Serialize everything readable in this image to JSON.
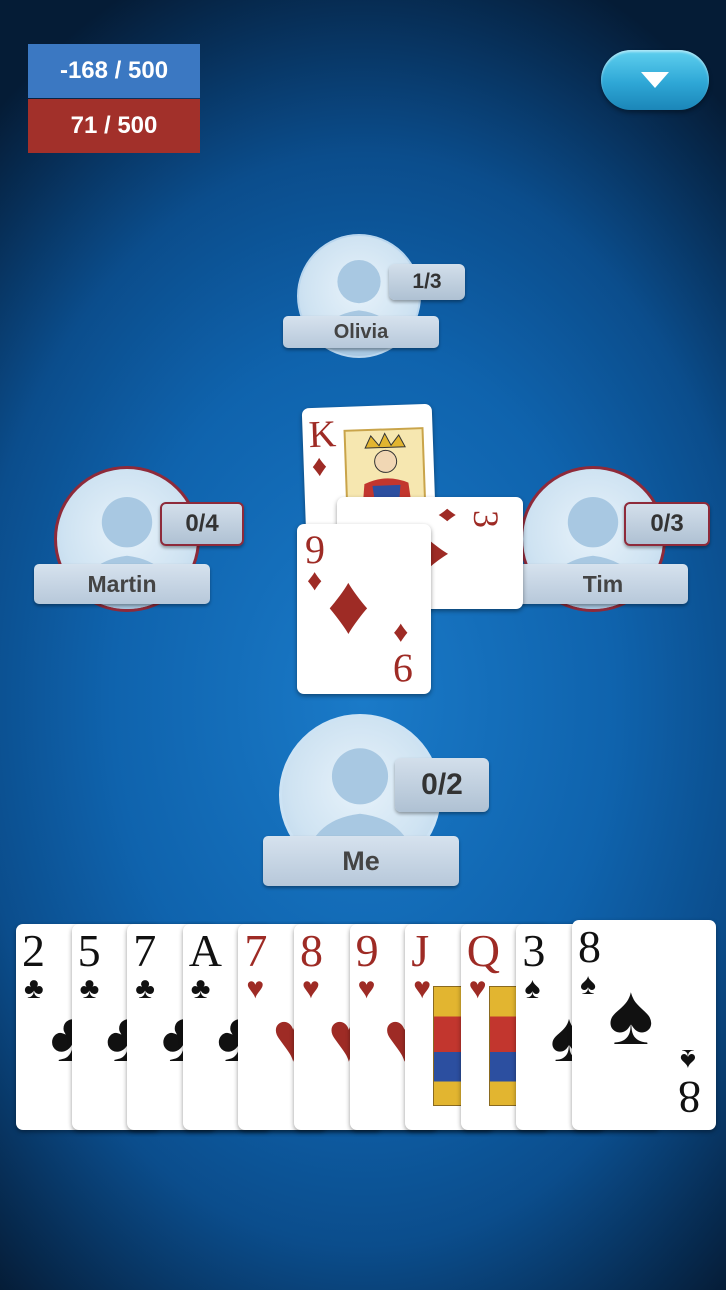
{
  "scores": {
    "team_blue": "-168 / 500",
    "team_red": "71 / 500"
  },
  "menu": {
    "icon": "chevron-down-icon"
  },
  "players": {
    "olivia": {
      "name": "Olivia",
      "tricks": "1/3"
    },
    "martin": {
      "name": "Martin",
      "tricks": "0/4"
    },
    "tim": {
      "name": "Tim",
      "tricks": "0/3"
    },
    "me": {
      "name": "Me",
      "tricks": "0/2"
    }
  },
  "trick": [
    {
      "rank": "K",
      "suit": "♦",
      "color": "red",
      "by": "Olivia"
    },
    {
      "rank": "3",
      "suit": "♦",
      "color": "red",
      "by": "Tim"
    },
    {
      "rank": "9",
      "suit": "♦",
      "color": "red",
      "by": "Me"
    }
  ],
  "hand": [
    {
      "rank": "2",
      "suit": "♣",
      "color": "black"
    },
    {
      "rank": "5",
      "suit": "♣",
      "color": "black"
    },
    {
      "rank": "7",
      "suit": "♣",
      "color": "black"
    },
    {
      "rank": "A",
      "suit": "♣",
      "color": "black"
    },
    {
      "rank": "7",
      "suit": "♥",
      "color": "red"
    },
    {
      "rank": "8",
      "suit": "♥",
      "color": "red"
    },
    {
      "rank": "9",
      "suit": "♥",
      "color": "red"
    },
    {
      "rank": "J",
      "suit": "♥",
      "color": "red"
    },
    {
      "rank": "Q",
      "suit": "♥",
      "color": "red"
    },
    {
      "rank": "3",
      "suit": "♠",
      "color": "black"
    },
    {
      "rank": "8",
      "suit": "♠",
      "color": "black"
    }
  ],
  "colors": {
    "team_blue": "#3b78c2",
    "team_red": "#a2302a",
    "card_red": "#9e2b25"
  }
}
